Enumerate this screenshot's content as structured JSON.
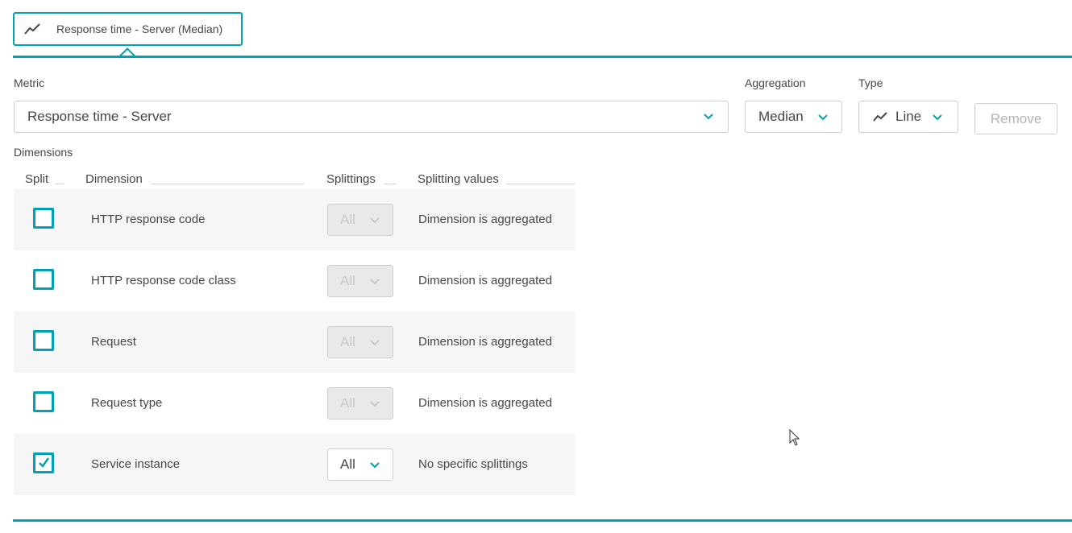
{
  "tab": {
    "label": "Response time - Server (Median)",
    "icon": "line-chart-icon"
  },
  "form": {
    "metric_label": "Metric",
    "metric_value": "Response time - Server",
    "aggregation_label": "Aggregation",
    "aggregation_value": "Median",
    "type_label": "Type",
    "type_value": "Line",
    "remove_label": "Remove"
  },
  "dimensions": {
    "title": "Dimensions",
    "columns": {
      "split": "Split",
      "dimension": "Dimension",
      "splittings": "Splittings",
      "values": "Splitting values"
    },
    "rows": [
      {
        "name": "HTTP response code",
        "checked": false,
        "splitting": "All",
        "value": "Dimension is aggregated"
      },
      {
        "name": "HTTP response code class",
        "checked": false,
        "splitting": "All",
        "value": "Dimension is aggregated"
      },
      {
        "name": "Request",
        "checked": false,
        "splitting": "All",
        "value": "Dimension is aggregated"
      },
      {
        "name": "Request type",
        "checked": false,
        "splitting": "All",
        "value": "Dimension is aggregated"
      },
      {
        "name": "Service instance",
        "checked": true,
        "splitting": "All",
        "value": "No specific splittings"
      }
    ]
  },
  "colors": {
    "accent": "#00a1b2",
    "text": "#454646",
    "disabled_text": "#b4b4b4",
    "row_shade": "#f6f6f6"
  }
}
